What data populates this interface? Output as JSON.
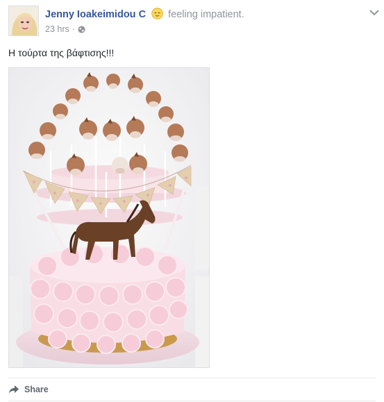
{
  "post": {
    "author": "Jenny Ioakeimidou C",
    "feeling": "feeling impatient.",
    "feeling_icon": "relieved-face-icon",
    "time": "23 hrs",
    "separator": "·",
    "privacy_icon": "globe-icon",
    "text": "Η τούρτα της βάφτισης!!!",
    "photo_description_icon": "cake-photo"
  },
  "actions": {
    "share_label": "Share"
  },
  "colors": {
    "author_link": "#365899",
    "meta_gray": "#90949c",
    "cream_pink": "#f6d3dd",
    "horse_brown": "#6a4026"
  }
}
